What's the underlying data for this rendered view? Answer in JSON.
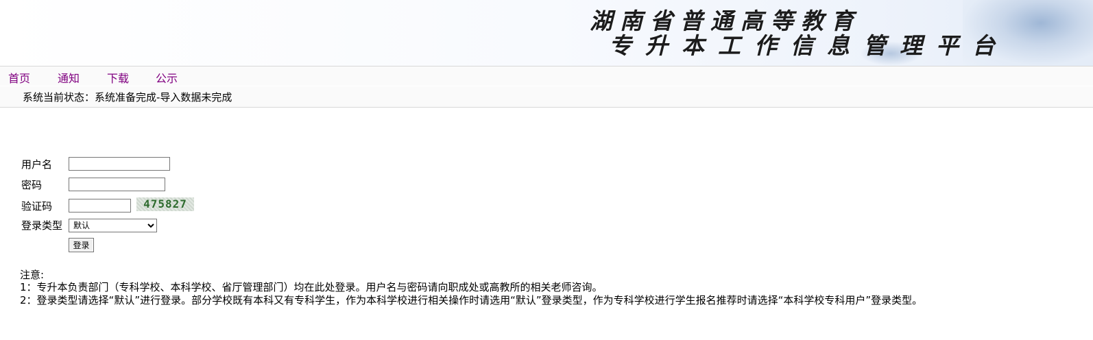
{
  "header": {
    "title_line1": "湖南省普通高等教育",
    "title_line2": "专升本工作信息管理平台"
  },
  "nav": {
    "items": [
      {
        "label": "首页"
      },
      {
        "label": "通知"
      },
      {
        "label": "下载"
      },
      {
        "label": "公示"
      }
    ],
    "link_color": "#800080"
  },
  "status": {
    "text": "系统当前状态：系统准备完成-导入数据未完成"
  },
  "login_form": {
    "username_label": "用户名",
    "username_value": "",
    "password_label": "密码",
    "password_value": "",
    "captcha_label": "验证码",
    "captcha_value": "",
    "captcha_image_text": "475827",
    "login_type_label": "登录类型",
    "login_type_selected": "默认",
    "submit_label": "登录"
  },
  "notes": {
    "heading": "注意:",
    "line1": "1：专升本负责部门（专科学校、本科学校、省厅管理部门）均在此处登录。用户名与密码请向职成处或高教所的相关老师咨询。",
    "line2": "2：登录类型请选择“默认”进行登录。部分学校既有本科又有专科学生，作为本科学校进行相关操作时请选用“默认”登录类型，作为专科学校进行学生报名推荐时请选择“本科学校专科用户”登录类型。"
  }
}
